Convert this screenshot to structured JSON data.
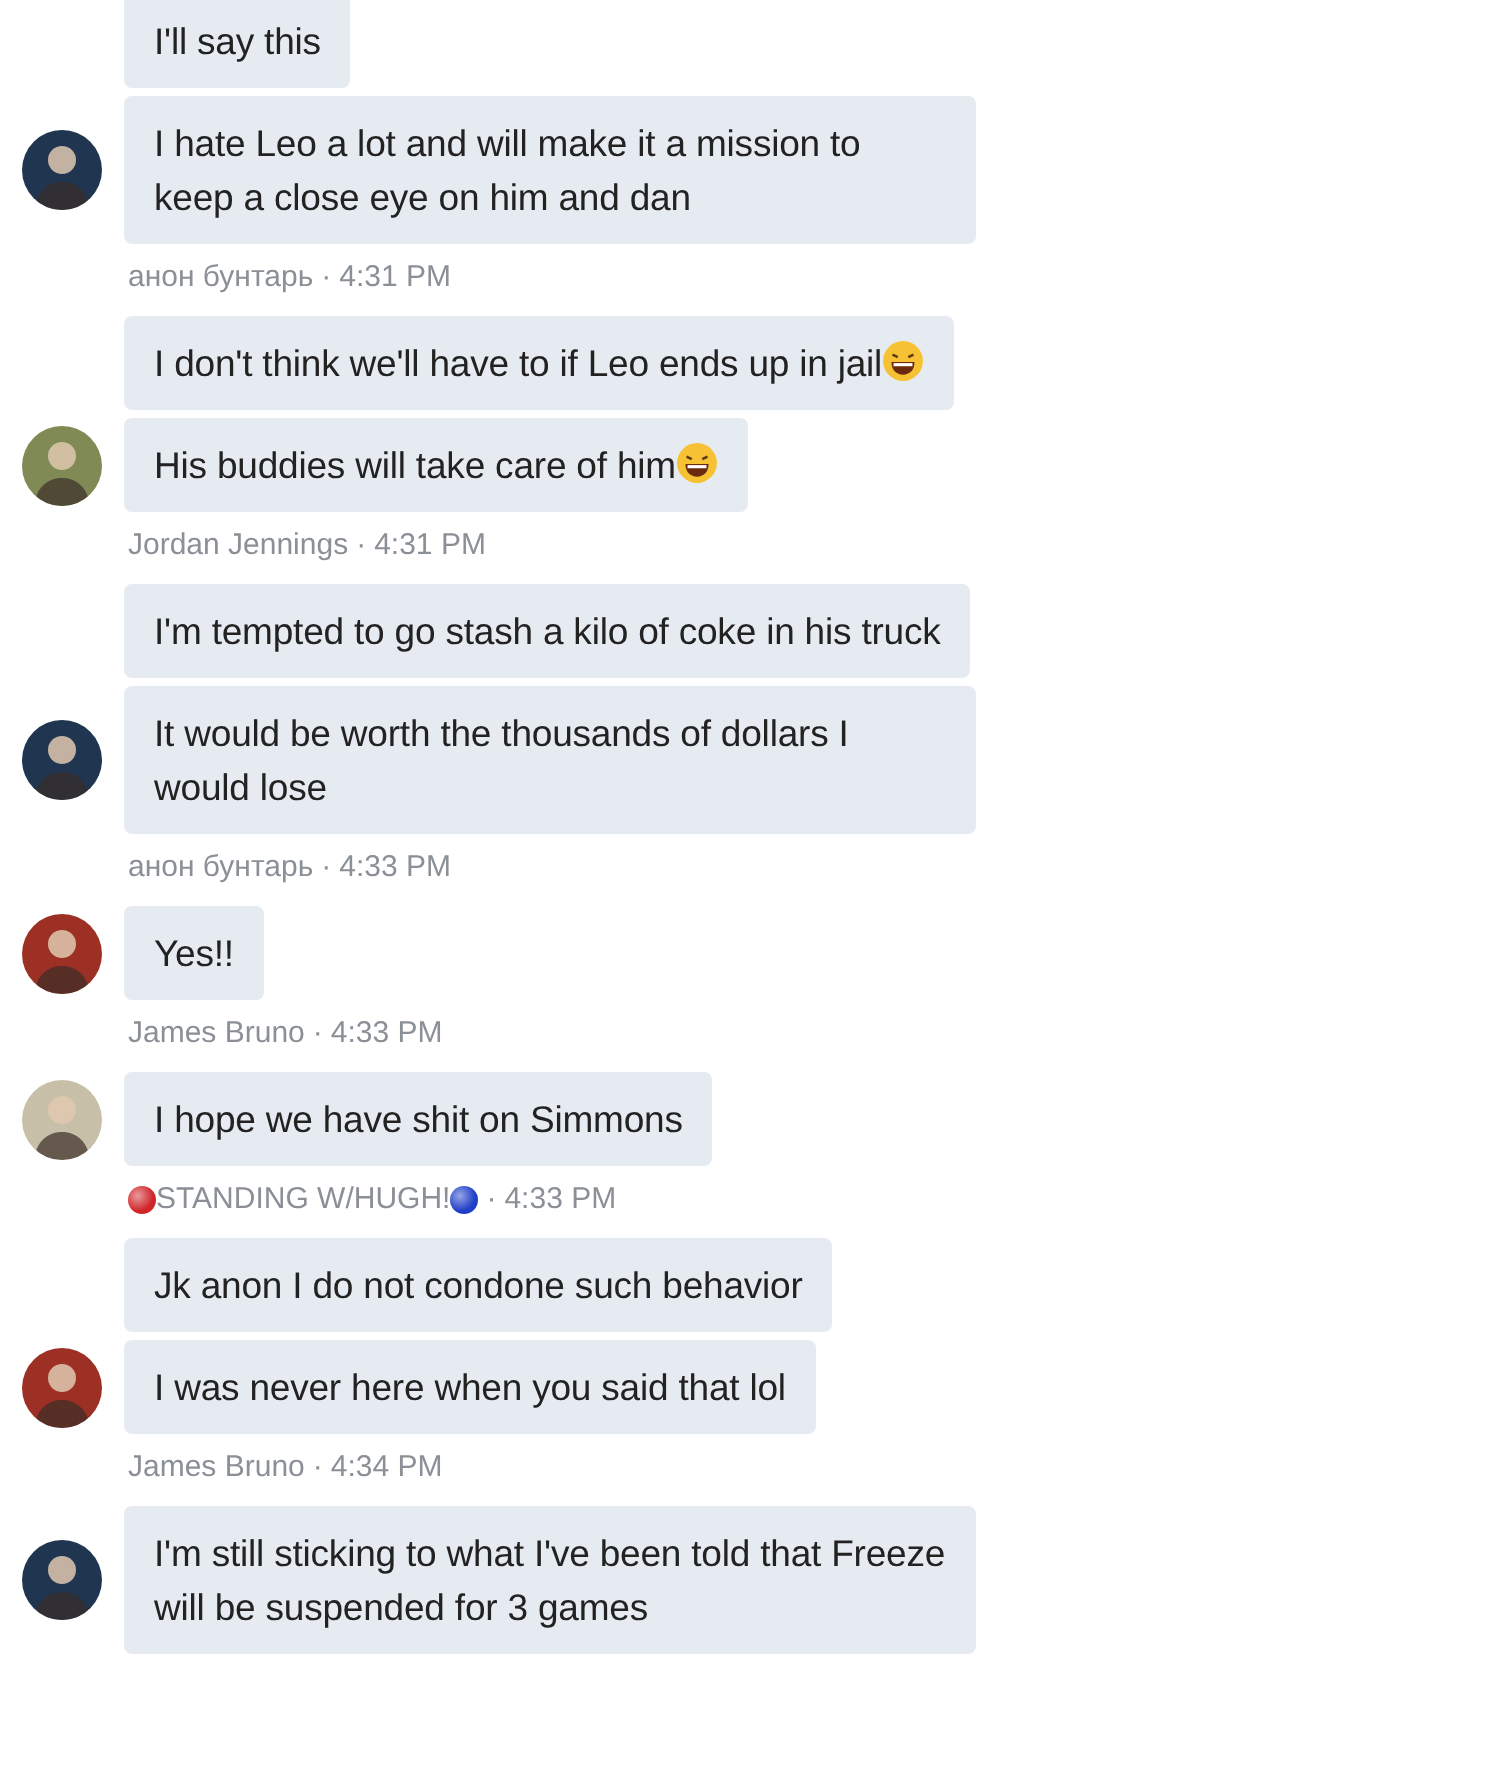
{
  "groups": [
    {
      "avatar": {
        "color": "#1f3550"
      },
      "messages": [
        {
          "text": "I'll say this",
          "emoji": false
        },
        {
          "text": "I hate Leo a lot and will make it a mission to keep a close eye on him and dan",
          "emoji": false
        }
      ],
      "sender": "анон бунтарь",
      "separator": "·",
      "time": "4:31 PM"
    },
    {
      "avatar": {
        "color": "#7f8a55"
      },
      "messages": [
        {
          "text": "I don't think we'll have to if Leo ends up in jail",
          "emoji": true
        },
        {
          "text": "His buddies will take care of him",
          "emoji": true
        }
      ],
      "sender": "Jordan Jennings",
      "separator": "·",
      "time": "4:31 PM"
    },
    {
      "avatar": {
        "color": "#1f3550"
      },
      "messages": [
        {
          "text": "I'm tempted to go stash a kilo of coke in his truck",
          "emoji": false
        },
        {
          "text": "It would be worth the thousands of dollars I would lose",
          "emoji": false
        }
      ],
      "sender": "анон бунтарь",
      "separator": "·",
      "time": "4:33 PM"
    },
    {
      "avatar": {
        "color": "#9c3024"
      },
      "messages": [
        {
          "text": "Yes!!",
          "emoji": false
        }
      ],
      "sender": "James Bruno",
      "separator": "·",
      "time": "4:33 PM"
    },
    {
      "avatar": {
        "color": "#c8bfa8"
      },
      "messages": [
        {
          "text": "I hope we have shit on Simmons",
          "emoji": false
        }
      ],
      "sender": "STANDING W/HUGH!",
      "dot_before": {
        "color": "#d0262a"
      },
      "dot_after": {
        "color": "#1f3fc8"
      },
      "separator": "·",
      "time": "4:33 PM"
    },
    {
      "avatar": {
        "color": "#9c3024"
      },
      "messages": [
        {
          "text": "Jk anon I do not condone such behavior",
          "emoji": false
        },
        {
          "text": "I was never here when you said that lol",
          "emoji": false
        }
      ],
      "sender": "James Bruno",
      "separator": "·",
      "time": "4:34 PM"
    },
    {
      "avatar": {
        "color": "#1f3550"
      },
      "messages": [
        {
          "text": "I'm still sticking to what I've been told that Freeze will be suspended for 3 games",
          "emoji": false
        }
      ]
    }
  ]
}
